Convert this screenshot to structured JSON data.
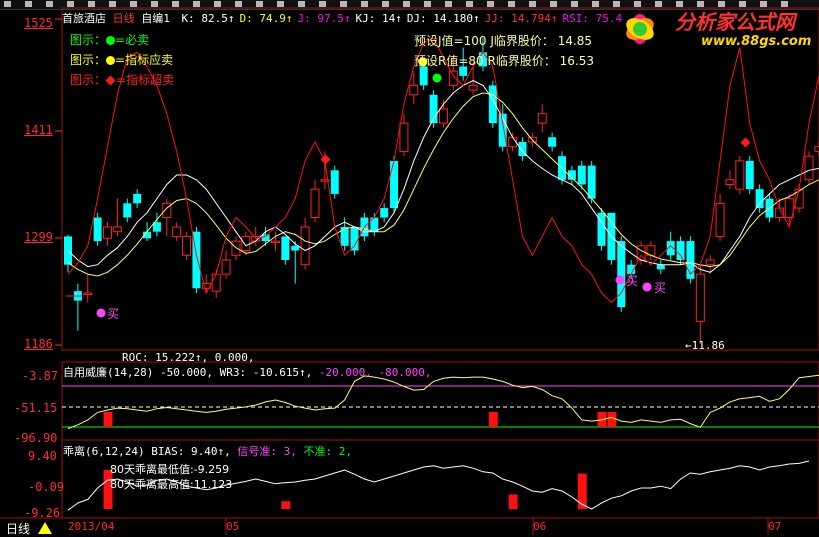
{
  "header": {
    "stock": "首旅酒店",
    "period": "日线",
    "formula": "自编1",
    "items": [
      {
        "k": "K:",
        "v": "82.5",
        "arrow": "↑",
        "color": "#ffffff"
      },
      {
        "k": "D:",
        "v": "74.9",
        "arrow": "↑",
        "color": "#ffff00"
      },
      {
        "k": "J:",
        "v": "97.5",
        "arrow": "↑",
        "color": "#ff00ff"
      },
      {
        "k": "KJ:",
        "v": "14",
        "arrow": "↑",
        "color": "#ffffff"
      },
      {
        "k": "DJ:",
        "v": "14.180",
        "arrow": "↑",
        "color": "#ffffff"
      },
      {
        "k": "JJ:",
        "v": "14.794",
        "arrow": "↑",
        "color": "#ff3030"
      },
      {
        "k": "RSI:",
        "v": "75.4",
        "arrow": "",
        "color": "#ff00ff"
      }
    ]
  },
  "legend": {
    "label": "图示：",
    "sell_must": "=必卖",
    "sell_should": "=指标应卖",
    "sell_over": "=指标超卖"
  },
  "preset": {
    "j_label": "预设J值=100",
    "j_price_label": "J临界股价：",
    "j_price": "14.85",
    "r_label": "预设R值=80",
    "r_price_label": "R临界股价：",
    "r_price": "16.53"
  },
  "main_axis": {
    "labels": [
      "1525",
      "1411",
      "1299",
      "1186"
    ],
    "ylim": [
      11.86,
      15.25
    ]
  },
  "signals": {
    "buy": "买",
    "min_label": "←11.86"
  },
  "wr_panel": {
    "roc": "ROC: 15.222↑, 0.000,",
    "name": "自用威廉(14,28)",
    "values": "-50.000, WR3: -10.615↑,",
    "levels": "-20.000, -80.000,",
    "axis": [
      "-3.87",
      "-51.15",
      "-96.90"
    ]
  },
  "bias_panel": {
    "name": "乖离(6,12,24)",
    "bias": "BIAS: 9.40↑,",
    "signal": "信号准: 3,",
    "nosignal": "不准: 2,",
    "axis": [
      "9.40",
      "-0.09",
      "-9.26"
    ],
    "note_min": "80天乖离最低值:-9.259",
    "note_max": "80天乖离最高值:11.123"
  },
  "xaxis": {
    "period": "日线",
    "ticks": [
      "2013/04",
      "05",
      "06",
      "07"
    ]
  },
  "logo": {
    "title": "分析家公式网",
    "url": "www.88gs.com"
  },
  "colors": {
    "up": "#ff2020",
    "down": "#00ffff",
    "ma_white": "#ffffff",
    "ma_yellow": "#ffff66",
    "kdj_red": "#ff1010"
  },
  "chart_data": {
    "type": "candlestick",
    "ylim": [
      11.86,
      15.25
    ],
    "candles": [
      [
        13.0,
        12.95,
        12.7,
        12.7,
        13.02,
        12.62
      ],
      [
        12.4,
        12.42,
        12.32,
        12.34,
        12.5,
        12.0
      ],
      [
        12.4,
        12.4,
        12.55,
        12.4,
        12.6,
        12.3
      ],
      [
        13.1,
        13.2,
        12.95,
        12.95,
        13.25,
        12.9
      ],
      [
        12.98,
        13.1,
        13.05,
        12.98,
        13.15,
        12.9
      ],
      [
        13.05,
        13.1,
        13.35,
        13.05,
        13.4,
        13.0
      ],
      [
        13.35,
        13.35,
        13.2,
        13.2,
        13.4,
        13.15
      ],
      [
        13.45,
        13.45,
        13.35,
        13.35,
        13.5,
        13.3
      ],
      [
        13.05,
        13.05,
        12.98,
        12.98,
        13.15,
        12.95
      ],
      [
        13.15,
        13.15,
        13.05,
        13.05,
        13.25,
        13.0
      ],
      [
        13.2,
        13.35,
        13.2,
        13.2,
        13.4,
        13.0
      ],
      [
        13.0,
        13.1,
        13.0,
        13.0,
        13.15,
        12.95
      ],
      [
        12.8,
        13.0,
        12.8,
        12.8,
        13.05,
        12.75
      ],
      [
        13.0,
        13.05,
        12.45,
        12.45,
        13.1,
        12.4
      ],
      [
        12.45,
        12.5,
        12.55,
        12.45,
        12.6,
        12.4
      ],
      [
        12.42,
        12.6,
        12.42,
        12.42,
        12.65,
        12.35
      ],
      [
        12.6,
        12.75,
        12.6,
        12.6,
        12.85,
        12.55
      ],
      [
        12.8,
        12.95,
        12.8,
        12.8,
        13.0,
        12.75
      ],
      [
        12.85,
        13.0,
        12.85,
        12.85,
        13.05,
        12.8
      ],
      [
        12.95,
        13.0,
        12.95,
        12.95,
        13.1,
        12.9
      ],
      [
        13.0,
        13.02,
        12.95,
        12.95,
        13.1,
        12.9
      ],
      [
        12.95,
        12.95,
        12.95,
        12.95,
        13.05,
        12.85
      ],
      [
        13.0,
        12.8,
        12.75,
        12.75,
        12.85,
        12.7
      ],
      [
        12.9,
        12.6,
        12.85,
        12.6,
        12.95,
        12.5
      ],
      [
        12.7,
        13.1,
        12.7,
        12.7,
        13.2,
        12.65
      ],
      [
        13.2,
        13.5,
        13.2,
        13.2,
        13.6,
        13.15
      ],
      [
        13.6,
        13.55,
        13.6,
        13.55,
        13.9,
        13.5
      ],
      [
        13.7,
        13.7,
        13.45,
        13.45,
        13.75,
        13.4
      ],
      [
        13.1,
        13.1,
        12.9,
        12.9,
        13.2,
        12.85
      ],
      [
        13.1,
        12.95,
        12.85,
        12.85,
        13.0,
        12.8
      ],
      [
        13.2,
        13.2,
        13.0,
        13.0,
        13.25,
        12.95
      ],
      [
        13.2,
        13.2,
        13.05,
        13.05,
        13.25,
        13.0
      ],
      [
        13.3,
        13.3,
        13.2,
        13.2,
        13.35,
        13.15
      ],
      [
        13.8,
        13.8,
        13.3,
        13.3,
        13.85,
        13.25
      ],
      [
        13.9,
        14.2,
        13.9,
        13.9,
        14.3,
        13.85
      ],
      [
        14.5,
        14.6,
        14.5,
        14.5,
        14.75,
        14.4
      ],
      [
        14.8,
        14.8,
        14.6,
        14.6,
        14.85,
        14.55
      ],
      [
        14.45,
        14.5,
        14.2,
        14.2,
        14.55,
        14.15
      ],
      [
        14.2,
        14.35,
        14.2,
        14.2,
        14.45,
        14.15
      ],
      [
        14.6,
        14.75,
        14.6,
        14.6,
        14.9,
        14.55
      ],
      [
        14.8,
        14.8,
        14.7,
        14.7,
        15.0,
        14.65
      ],
      [
        14.55,
        14.6,
        14.55,
        14.55,
        14.85,
        14.5
      ],
      [
        14.9,
        14.95,
        14.8,
        14.8,
        15.1,
        14.75
      ],
      [
        14.4,
        14.6,
        14.2,
        14.2,
        14.65,
        14.15
      ],
      [
        14.2,
        14.3,
        13.95,
        13.95,
        14.4,
        13.9
      ],
      [
        13.95,
        14.05,
        13.95,
        13.95,
        14.1,
        13.9
      ],
      [
        13.95,
        14.0,
        13.85,
        13.85,
        14.05,
        13.8
      ],
      [
        14.0,
        14.05,
        14.0,
        14.0,
        14.1,
        13.95
      ],
      [
        14.2,
        14.3,
        14.2,
        14.2,
        14.4,
        14.1
      ],
      [
        14.0,
        14.05,
        13.95,
        13.95,
        14.1,
        13.9
      ],
      [
        13.8,
        13.85,
        13.6,
        13.6,
        13.9,
        13.55
      ],
      [
        13.7,
        13.7,
        13.6,
        13.6,
        13.75,
        13.55
      ],
      [
        13.75,
        13.75,
        13.55,
        13.55,
        13.8,
        13.5
      ],
      [
        13.75,
        13.75,
        13.4,
        13.4,
        13.8,
        13.35
      ],
      [
        13.25,
        13.25,
        12.9,
        12.9,
        13.3,
        12.85
      ],
      [
        13.25,
        12.9,
        12.75,
        12.75,
        12.95,
        12.7
      ],
      [
        12.95,
        12.95,
        12.25,
        12.25,
        13.0,
        12.2
      ],
      [
        12.7,
        12.7,
        12.6,
        12.6,
        12.75,
        12.55
      ],
      [
        12.75,
        12.9,
        12.75,
        12.75,
        12.95,
        12.7
      ],
      [
        12.8,
        12.9,
        12.8,
        12.8,
        12.95,
        12.75
      ],
      [
        12.7,
        12.7,
        12.65,
        12.65,
        12.75,
        12.6
      ],
      [
        12.95,
        12.95,
        12.8,
        12.8,
        13.05,
        12.75
      ],
      [
        12.85,
        12.95,
        12.75,
        12.75,
        13.0,
        12.7
      ],
      [
        12.95,
        12.95,
        12.55,
        12.55,
        13.0,
        12.5
      ],
      [
        12.1,
        12.6,
        12.1,
        12.1,
        12.7,
        11.86
      ],
      [
        12.7,
        12.75,
        12.7,
        12.7,
        12.8,
        12.6
      ],
      [
        13.0,
        13.35,
        13.0,
        13.0,
        13.45,
        12.95
      ],
      [
        13.55,
        13.6,
        13.55,
        13.55,
        13.7,
        13.5
      ],
      [
        13.5,
        13.8,
        13.5,
        13.5,
        13.85,
        13.45
      ],
      [
        13.8,
        13.8,
        13.5,
        13.5,
        13.85,
        13.45
      ],
      [
        13.5,
        13.5,
        13.3,
        13.3,
        13.55,
        13.25
      ],
      [
        13.4,
        13.4,
        13.2,
        13.2,
        13.45,
        13.15
      ],
      [
        13.2,
        13.3,
        13.2,
        13.2,
        13.4,
        13.15
      ],
      [
        13.2,
        13.4,
        13.2,
        13.2,
        13.45,
        13.1
      ],
      [
        13.3,
        13.5,
        13.3,
        13.3,
        13.55,
        13.25
      ],
      [
        13.6,
        13.85,
        13.6,
        13.6,
        13.9,
        13.55
      ],
      [
        13.9,
        13.95,
        13.9,
        13.9,
        14.0,
        13.85
      ]
    ],
    "ma_white": [
      12.85,
      12.75,
      12.68,
      12.7,
      12.8,
      12.88,
      13.0,
      13.15,
      13.25,
      13.4,
      13.55,
      13.65,
      13.65,
      13.6,
      13.5,
      13.35,
      13.2,
      13.05,
      12.9,
      12.95,
      13.05,
      13.1,
      13.02,
      12.92,
      12.85,
      12.9,
      13.0,
      13.1,
      13.15,
      13.1,
      13.05,
      13.05,
      13.1,
      13.25,
      13.5,
      13.8,
      14.05,
      14.25,
      14.4,
      14.52,
      14.6,
      14.65,
      14.6,
      14.45,
      14.25,
      14.05,
      13.9,
      13.8,
      13.72,
      13.65,
      13.6,
      13.55,
      13.45,
      13.3,
      13.15,
      13.0,
      12.9,
      12.82,
      12.75,
      12.72,
      12.7,
      12.7,
      12.7,
      12.72,
      12.65,
      12.62,
      12.7,
      12.85,
      13.0,
      13.2,
      13.35,
      13.45,
      13.55,
      13.6,
      13.65,
      13.7,
      13.72
    ],
    "ma_yellow": [
      12.72,
      12.65,
      12.6,
      12.58,
      12.62,
      12.7,
      12.8,
      12.92,
      13.05,
      13.18,
      13.3,
      13.38,
      13.4,
      13.35,
      13.25,
      13.12,
      12.98,
      12.88,
      12.82,
      12.84,
      12.92,
      13.0,
      13.05,
      13.02,
      12.95,
      12.92,
      12.95,
      13.02,
      13.08,
      13.1,
      13.08,
      13.05,
      13.05,
      13.12,
      13.28,
      13.5,
      13.72,
      13.92,
      14.1,
      14.25,
      14.38,
      14.48,
      14.52,
      14.5,
      14.42,
      14.3,
      14.15,
      14.02,
      13.92,
      13.82,
      13.72,
      13.62,
      13.52,
      13.4,
      13.28,
      13.15,
      13.02,
      12.92,
      12.85,
      12.8,
      12.76,
      12.74,
      12.72,
      12.72,
      12.7,
      12.68,
      12.7,
      12.8,
      12.95,
      13.1,
      13.22,
      13.3,
      13.38,
      13.42,
      13.48,
      13.55,
      13.6
    ]
  },
  "kdj_red": [
    12.6,
    12.72,
    12.9,
    13.4,
    13.95,
    14.5,
    14.9,
    14.95,
    14.8,
    14.6,
    14.3,
    13.9,
    13.4,
    12.8,
    12.4,
    12.6,
    13.0,
    13.2,
    13.1,
    12.98,
    13.0,
    13.1,
    13.2,
    13.4,
    13.8,
    14.0,
    13.8,
    13.1,
    12.8,
    12.9,
    13.1,
    13.2,
    13.4,
    13.8,
    14.4,
    14.8,
    15.05,
    15.1,
    14.9,
    14.7,
    14.6,
    14.8,
    14.95,
    14.8,
    14.2,
    13.6,
    13.0,
    12.8,
    13.0,
    13.2,
    13.0,
    12.9,
    12.7,
    12.6,
    12.4,
    12.3,
    12.4,
    12.6,
    12.8,
    12.7,
    12.8,
    12.9,
    12.8,
    12.6,
    12.7,
    13.0,
    13.8,
    14.6,
    15.0,
    14.2,
    13.8,
    13.6,
    13.3,
    13.1,
    13.5,
    14.2,
    14.7
  ],
  "wr_line": [
    0.88,
    0.82,
    0.74,
    0.62,
    0.58,
    0.55,
    0.56,
    0.58,
    0.6,
    0.56,
    0.54,
    0.56,
    0.58,
    0.6,
    0.62,
    0.6,
    0.57,
    0.55,
    0.53,
    0.5,
    0.45,
    0.42,
    0.46,
    0.52,
    0.55,
    0.58,
    0.56,
    0.55,
    0.42,
    0.12,
    0.03,
    0.05,
    0.08,
    0.13,
    0.2,
    0.26,
    0.25,
    0.12,
    0.07,
    0.05,
    0.06,
    0.05,
    0.05,
    0.08,
    0.12,
    0.18,
    0.22,
    0.2,
    0.25,
    0.35,
    0.4,
    0.55,
    0.74,
    0.76,
    0.74,
    0.7,
    0.76,
    0.78,
    0.74,
    0.76,
    0.78,
    0.74,
    0.73,
    0.8,
    0.86,
    0.62,
    0.55,
    0.45,
    0.4,
    0.38,
    0.36,
    0.44,
    0.4,
    0.25,
    0.06,
    0.04,
    0.02
  ],
  "wr_bars": [
    4,
    43,
    54,
    55
  ],
  "bias_line": [
    0.92,
    0.8,
    0.74,
    0.55,
    0.42,
    0.4,
    0.45,
    0.52,
    0.5,
    0.42,
    0.4,
    0.45,
    0.52,
    0.55,
    0.58,
    0.55,
    0.5,
    0.47,
    0.44,
    0.4,
    0.44,
    0.48,
    0.46,
    0.45,
    0.42,
    0.4,
    0.35,
    0.3,
    0.25,
    0.32,
    0.4,
    0.45,
    0.4,
    0.35,
    0.3,
    0.25,
    0.2,
    0.18,
    0.22,
    0.2,
    0.18,
    0.22,
    0.28,
    0.3,
    0.4,
    0.45,
    0.52,
    0.6,
    0.62,
    0.56,
    0.6,
    0.7,
    0.82,
    0.9,
    0.8,
    0.72,
    0.68,
    0.6,
    0.55,
    0.55,
    0.52,
    0.56,
    0.4,
    0.3,
    0.32,
    0.28,
    0.25,
    0.22,
    0.18,
    0.2,
    0.25,
    0.2,
    0.18,
    0.15,
    0.14,
    0.1
  ],
  "bias_bars": [
    {
      "i": 4,
      "h": 0.75
    },
    {
      "i": 22,
      "h": 0.15
    },
    {
      "i": 45,
      "h": 0.28
    },
    {
      "i": 52,
      "h": 0.68
    }
  ]
}
